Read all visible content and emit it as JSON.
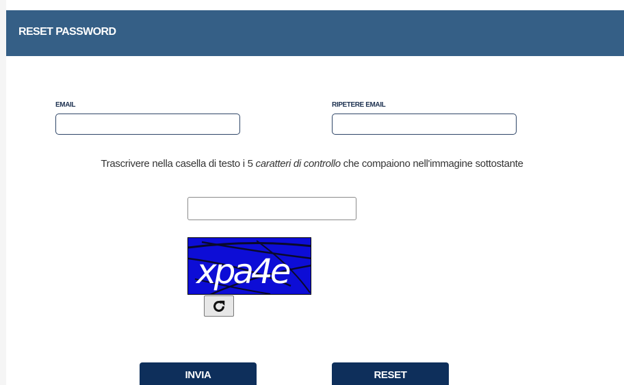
{
  "header": {
    "title": "RESET PASSWORD"
  },
  "form": {
    "email_label": "EMAIL",
    "email_value": "",
    "repeat_email_label": "RIPETERE EMAIL",
    "repeat_email_value": ""
  },
  "captcha": {
    "instruction_before": "Trascrivere nella casella di testo i 5 ",
    "instruction_emphasis": "caratteri di controllo",
    "instruction_after": " che compaiono nell'immagine sottostante",
    "input_value": "",
    "image_text": "xpa4e",
    "refresh_icon": "refresh-icon"
  },
  "actions": {
    "submit_label": "INVIA",
    "reset_label": "RESET"
  },
  "colors": {
    "header_bg": "#355f86",
    "button_bg": "#0e2f5b",
    "captcha_bg": "#0d0dd6"
  }
}
